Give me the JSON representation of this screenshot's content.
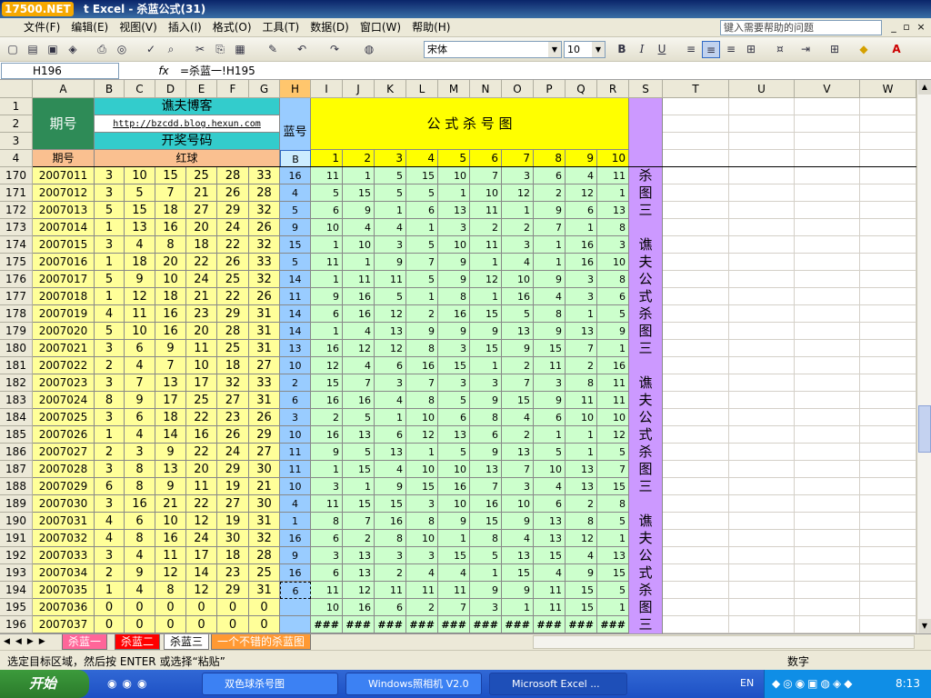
{
  "window": {
    "logo": "17500.NET",
    "title": "t Excel - 杀蓝公式(31)"
  },
  "menu": {
    "items": [
      "文件(F)",
      "编辑(E)",
      "视图(V)",
      "插入(I)",
      "格式(O)",
      "工具(T)",
      "数据(D)",
      "窗口(W)",
      "帮助(H)"
    ],
    "help_placeholder": "键入需要帮助的问题"
  },
  "toolbar": {
    "font_name": "宋体",
    "font_size": "10",
    "bold": "B",
    "italic": "I",
    "underline": "U"
  },
  "formula_bar": {
    "cell_ref": "H196",
    "fx": "fx",
    "formula": "=杀蓝一!H195"
  },
  "sheet": {
    "columns": [
      "A",
      "B",
      "C",
      "D",
      "E",
      "F",
      "G",
      "H",
      "I",
      "J",
      "K",
      "L",
      "M",
      "N",
      "O",
      "P",
      "Q",
      "R",
      "S",
      "T",
      "U",
      "V",
      "W"
    ],
    "header_rows": [
      "1",
      "2",
      "3",
      "4"
    ],
    "h_qihao": "期号",
    "blog_name": "谯夫博客",
    "blog_url": "http://bzcdd.blog.hexun.com",
    "kaijiang": "开奖号码",
    "lanhao": "蓝号",
    "formula_title": "公 式 杀 号 图",
    "qihao4": "期号",
    "hongqiu": "红球",
    "b_label": "B",
    "nums": [
      "1",
      "2",
      "3",
      "4",
      "5",
      "6",
      "7",
      "8",
      "9",
      "10"
    ],
    "side_text": [
      "杀",
      "图",
      "三",
      "",
      "谯",
      "夫",
      "公",
      "式",
      "杀",
      "图",
      "三",
      "",
      "谯",
      "夫",
      "公",
      "式",
      "杀",
      "图",
      "三",
      "",
      "谯",
      "夫",
      "公",
      "式",
      "杀",
      "图",
      "三"
    ],
    "rows": [
      {
        "r": "170",
        "id": "2007011",
        "red": [
          "3",
          "10",
          "15",
          "25",
          "28",
          "33"
        ],
        "blue": "16",
        "f": [
          "11",
          "1",
          "5",
          "15",
          "10",
          "7",
          "3",
          "6",
          "4",
          "11"
        ]
      },
      {
        "r": "171",
        "id": "2007012",
        "red": [
          "3",
          "5",
          "7",
          "21",
          "26",
          "28"
        ],
        "blue": "4",
        "f": [
          "5",
          "15",
          "5",
          "5",
          "1",
          "10",
          "12",
          "2",
          "12",
          "1"
        ]
      },
      {
        "r": "172",
        "id": "2007013",
        "red": [
          "5",
          "15",
          "18",
          "27",
          "29",
          "32"
        ],
        "blue": "5",
        "f": [
          "6",
          "9",
          "1",
          "6",
          "13",
          "11",
          "1",
          "9",
          "6",
          "13"
        ]
      },
      {
        "r": "173",
        "id": "2007014",
        "red": [
          "1",
          "13",
          "16",
          "20",
          "24",
          "26"
        ],
        "blue": "9",
        "f": [
          "10",
          "4",
          "4",
          "1",
          "3",
          "2",
          "2",
          "7",
          "1",
          "8"
        ]
      },
      {
        "r": "174",
        "id": "2007015",
        "red": [
          "3",
          "4",
          "8",
          "18",
          "22",
          "32"
        ],
        "blue": "15",
        "f": [
          "1",
          "10",
          "3",
          "5",
          "10",
          "11",
          "3",
          "1",
          "16",
          "3"
        ]
      },
      {
        "r": "175",
        "id": "2007016",
        "red": [
          "1",
          "18",
          "20",
          "22",
          "26",
          "33"
        ],
        "blue": "5",
        "f": [
          "11",
          "1",
          "9",
          "7",
          "9",
          "1",
          "4",
          "1",
          "16",
          "10"
        ]
      },
      {
        "r": "176",
        "id": "2007017",
        "red": [
          "5",
          "9",
          "10",
          "24",
          "25",
          "32"
        ],
        "blue": "14",
        "f": [
          "1",
          "11",
          "11",
          "5",
          "9",
          "12",
          "10",
          "9",
          "3",
          "8"
        ]
      },
      {
        "r": "177",
        "id": "2007018",
        "red": [
          "1",
          "12",
          "18",
          "21",
          "22",
          "26"
        ],
        "blue": "11",
        "f": [
          "9",
          "16",
          "5",
          "1",
          "8",
          "1",
          "16",
          "4",
          "3",
          "6"
        ]
      },
      {
        "r": "178",
        "id": "2007019",
        "red": [
          "4",
          "11",
          "16",
          "23",
          "29",
          "31"
        ],
        "blue": "14",
        "f": [
          "6",
          "16",
          "12",
          "2",
          "16",
          "15",
          "5",
          "8",
          "1",
          "5"
        ]
      },
      {
        "r": "179",
        "id": "2007020",
        "red": [
          "5",
          "10",
          "16",
          "20",
          "28",
          "31"
        ],
        "blue": "14",
        "f": [
          "1",
          "4",
          "13",
          "9",
          "9",
          "9",
          "13",
          "9",
          "13",
          "9"
        ]
      },
      {
        "r": "180",
        "id": "2007021",
        "red": [
          "3",
          "6",
          "9",
          "11",
          "25",
          "31"
        ],
        "blue": "13",
        "f": [
          "16",
          "12",
          "12",
          "8",
          "3",
          "15",
          "9",
          "15",
          "7",
          "1"
        ]
      },
      {
        "r": "181",
        "id": "2007022",
        "red": [
          "2",
          "4",
          "7",
          "10",
          "18",
          "27"
        ],
        "blue": "10",
        "f": [
          "12",
          "4",
          "6",
          "16",
          "15",
          "1",
          "2",
          "11",
          "2",
          "16"
        ]
      },
      {
        "r": "182",
        "id": "2007023",
        "red": [
          "3",
          "7",
          "13",
          "17",
          "32",
          "33"
        ],
        "blue": "2",
        "f": [
          "15",
          "7",
          "3",
          "7",
          "3",
          "3",
          "7",
          "3",
          "8",
          "11"
        ]
      },
      {
        "r": "183",
        "id": "2007024",
        "red": [
          "8",
          "9",
          "17",
          "25",
          "27",
          "31"
        ],
        "blue": "6",
        "f": [
          "16",
          "16",
          "4",
          "8",
          "5",
          "9",
          "15",
          "9",
          "11",
          "11"
        ]
      },
      {
        "r": "184",
        "id": "2007025",
        "red": [
          "3",
          "6",
          "18",
          "22",
          "23",
          "26"
        ],
        "blue": "3",
        "f": [
          "2",
          "5",
          "1",
          "10",
          "6",
          "8",
          "4",
          "6",
          "10",
          "10"
        ]
      },
      {
        "r": "185",
        "id": "2007026",
        "red": [
          "1",
          "4",
          "14",
          "16",
          "26",
          "29"
        ],
        "blue": "10",
        "f": [
          "16",
          "13",
          "6",
          "12",
          "13",
          "6",
          "2",
          "1",
          "1",
          "12"
        ]
      },
      {
        "r": "186",
        "id": "2007027",
        "red": [
          "2",
          "3",
          "9",
          "22",
          "24",
          "27"
        ],
        "blue": "11",
        "f": [
          "9",
          "5",
          "13",
          "1",
          "5",
          "9",
          "13",
          "5",
          "1",
          "5"
        ]
      },
      {
        "r": "187",
        "id": "2007028",
        "red": [
          "3",
          "8",
          "13",
          "20",
          "29",
          "30"
        ],
        "blue": "11",
        "f": [
          "1",
          "15",
          "4",
          "10",
          "10",
          "13",
          "7",
          "10",
          "13",
          "7"
        ]
      },
      {
        "r": "188",
        "id": "2007029",
        "red": [
          "6",
          "8",
          "9",
          "11",
          "19",
          "21"
        ],
        "blue": "10",
        "f": [
          "3",
          "1",
          "9",
          "15",
          "16",
          "7",
          "3",
          "4",
          "13",
          "15"
        ]
      },
      {
        "r": "189",
        "id": "2007030",
        "red": [
          "3",
          "16",
          "21",
          "22",
          "27",
          "30"
        ],
        "blue": "4",
        "f": [
          "11",
          "15",
          "15",
          "3",
          "10",
          "16",
          "10",
          "6",
          "2",
          "8"
        ]
      },
      {
        "r": "190",
        "id": "2007031",
        "red": [
          "4",
          "6",
          "10",
          "12",
          "19",
          "31"
        ],
        "blue": "1",
        "f": [
          "8",
          "7",
          "16",
          "8",
          "9",
          "15",
          "9",
          "13",
          "8",
          "5"
        ]
      },
      {
        "r": "191",
        "id": "2007032",
        "red": [
          "4",
          "8",
          "16",
          "24",
          "30",
          "32"
        ],
        "blue": "16",
        "f": [
          "6",
          "2",
          "8",
          "10",
          "1",
          "8",
          "4",
          "13",
          "12",
          "1"
        ]
      },
      {
        "r": "192",
        "id": "2007033",
        "red": [
          "3",
          "4",
          "11",
          "17",
          "18",
          "28"
        ],
        "blue": "9",
        "f": [
          "3",
          "13",
          "3",
          "3",
          "15",
          "5",
          "13",
          "15",
          "4",
          "13"
        ]
      },
      {
        "r": "193",
        "id": "2007034",
        "red": [
          "2",
          "9",
          "12",
          "14",
          "23",
          "25"
        ],
        "blue": "16",
        "f": [
          "6",
          "13",
          "2",
          "4",
          "4",
          "1",
          "15",
          "4",
          "9",
          "15"
        ]
      },
      {
        "r": "194",
        "id": "2007035",
        "red": [
          "1",
          "4",
          "8",
          "12",
          "29",
          "31"
        ],
        "blue": "6",
        "f": [
          "11",
          "12",
          "11",
          "11",
          "11",
          "9",
          "9",
          "11",
          "15",
          "5"
        ]
      },
      {
        "r": "195",
        "id": "2007036",
        "red": [
          "0",
          "0",
          "0",
          "0",
          "0",
          "0"
        ],
        "blue": "",
        "f": [
          "10",
          "16",
          "6",
          "2",
          "7",
          "3",
          "1",
          "11",
          "15",
          "1"
        ]
      },
      {
        "r": "196",
        "id": "2007037",
        "red": [
          "0",
          "0",
          "0",
          "0",
          "0",
          "0"
        ],
        "blue": "",
        "f": [
          "###",
          "###",
          "###",
          "###",
          "###",
          "###",
          "###",
          "###",
          "###",
          "###"
        ]
      }
    ]
  },
  "tabs": [
    "杀蓝一",
    "杀蓝二",
    "杀蓝三",
    "一个不错的杀蓝图"
  ],
  "status": {
    "message": "选定目标区域，然后按 ENTER 或选择“粘贴”",
    "mode": "数字"
  },
  "taskbar": {
    "start": "开始",
    "tasks": [
      "双色球杀号图",
      "Windows照相机 V2.0",
      "Microsoft Excel ..."
    ],
    "lang": "EN",
    "clock": "8:13"
  },
  "colors": {
    "green": "#2e8b57",
    "cyan": "#33cccc",
    "yellow": "#ffff00",
    "peach": "#fac090",
    "lightyellow": "#ffff99",
    "blue": "#99ccff",
    "lightgreen": "#ccffcc",
    "purple": "#cc99ff"
  }
}
